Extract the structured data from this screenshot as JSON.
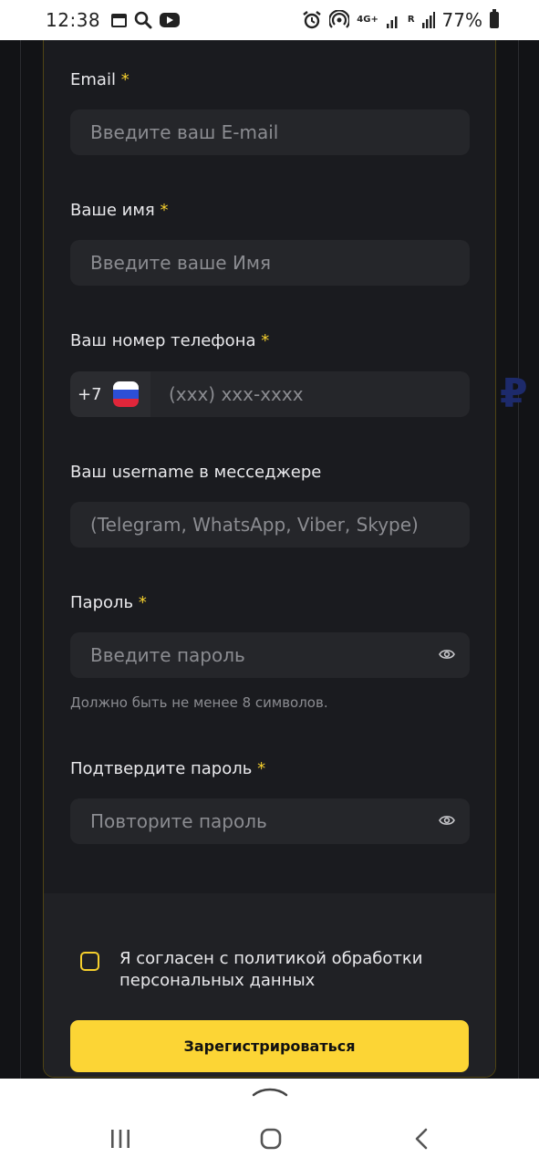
{
  "status_bar": {
    "time": "12:38",
    "network": "4G+",
    "signal_r": "R",
    "battery": "77%",
    "icons": [
      "calendar-icon",
      "search-icon",
      "youtube-icon",
      "alarm-icon",
      "hotspot-icon",
      "signal-icon",
      "battery-icon"
    ]
  },
  "form": {
    "required_mark": "*",
    "email": {
      "label": "Email",
      "placeholder": "Введите ваш E-mail"
    },
    "name": {
      "label": "Ваше имя",
      "placeholder": "Введите ваше Имя"
    },
    "phone": {
      "label": "Ваш номер телефона",
      "country_code": "+7",
      "placeholder": "(xxx) xxx-xxxx"
    },
    "username": {
      "label": "Ваш username в месседжере",
      "placeholder": "(Telegram, WhatsApp, Viber, Skype)"
    },
    "password": {
      "label": "Пароль",
      "placeholder": "Введите пароль",
      "hint": "Должно быть не менее 8 символов."
    },
    "confirm": {
      "label": "Подтвердите пароль",
      "placeholder": "Повторите пароль"
    },
    "consent": "Я согласен с политикой обработки персональных данных",
    "consent_checked": false,
    "submit_label": "Зарегистрироваться"
  },
  "colors": {
    "accent": "#fcd535",
    "background": "#121316",
    "card": "#1a1b1f",
    "input": "#25262a",
    "text": "#e9e9ec",
    "placeholder": "#8b8c91"
  }
}
